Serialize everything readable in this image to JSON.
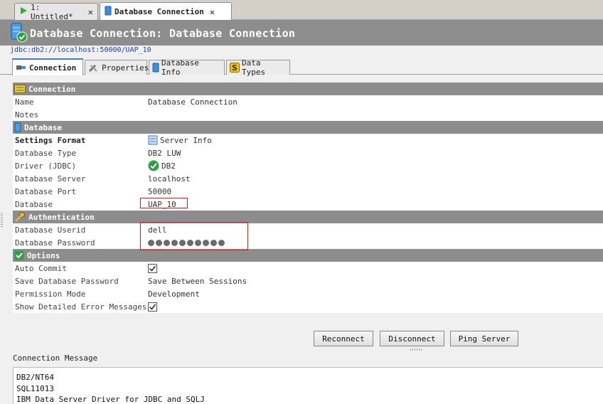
{
  "editor_tabs": [
    {
      "label": "1: Untitled*",
      "active": false
    },
    {
      "label": "Database Connection",
      "active": true
    }
  ],
  "header": {
    "title": "Database Connection: Database Connection",
    "url": "jdbc:db2://localhost:50000/UAP_10"
  },
  "subtabs": [
    {
      "label": "Connection",
      "icon": "plug-icon"
    },
    {
      "label": "Properties",
      "icon": "tools-icon"
    },
    {
      "label": "Database Info",
      "icon": "database-icon"
    },
    {
      "label": "Data Types",
      "icon": "datatype-s-icon"
    }
  ],
  "sections": {
    "connection": "Connection",
    "database": "Database",
    "authentication": "Authentication",
    "options": "Options"
  },
  "props": {
    "name": {
      "key": "Name",
      "value": "Database Connection"
    },
    "notes": {
      "key": "Notes",
      "value": ""
    },
    "settings_format": {
      "key": "Settings Format",
      "value": "Server Info"
    },
    "db_type": {
      "key": "Database Type",
      "value": "DB2 LUW"
    },
    "driver": {
      "key": "Driver (JDBC)",
      "value": "DB2"
    },
    "db_server": {
      "key": "Database Server",
      "value": "localhost"
    },
    "db_port": {
      "key": "Database Port",
      "value": "50000"
    },
    "database": {
      "key": "Database",
      "value": "UAP_10"
    },
    "userid": {
      "key": "Database Userid",
      "value": "dell"
    },
    "password": {
      "key": "Database Password",
      "masked_length": 10
    },
    "auto_commit": {
      "key": "Auto Commit",
      "checked": true
    },
    "save_password": {
      "key": "Save Database Password",
      "value": "Save Between Sessions"
    },
    "permission": {
      "key": "Permission Mode",
      "value": "Development"
    },
    "show_errors": {
      "key": "Show Detailed Error Messages",
      "checked": true
    }
  },
  "buttons": {
    "reconnect": "Reconnect",
    "disconnect": "Disconnect",
    "ping": "Ping Server"
  },
  "message": {
    "label": "Connection Message",
    "lines": [
      "DB2/NT64",
      "SQL11013",
      "IBM Data Server Driver for JDBC and SQLJ"
    ]
  },
  "colors": {
    "header_bg": "#8d8d8d",
    "highlight_box": "#e02020",
    "url_link": "#1a3fb0",
    "check_green": "#2ea043"
  }
}
